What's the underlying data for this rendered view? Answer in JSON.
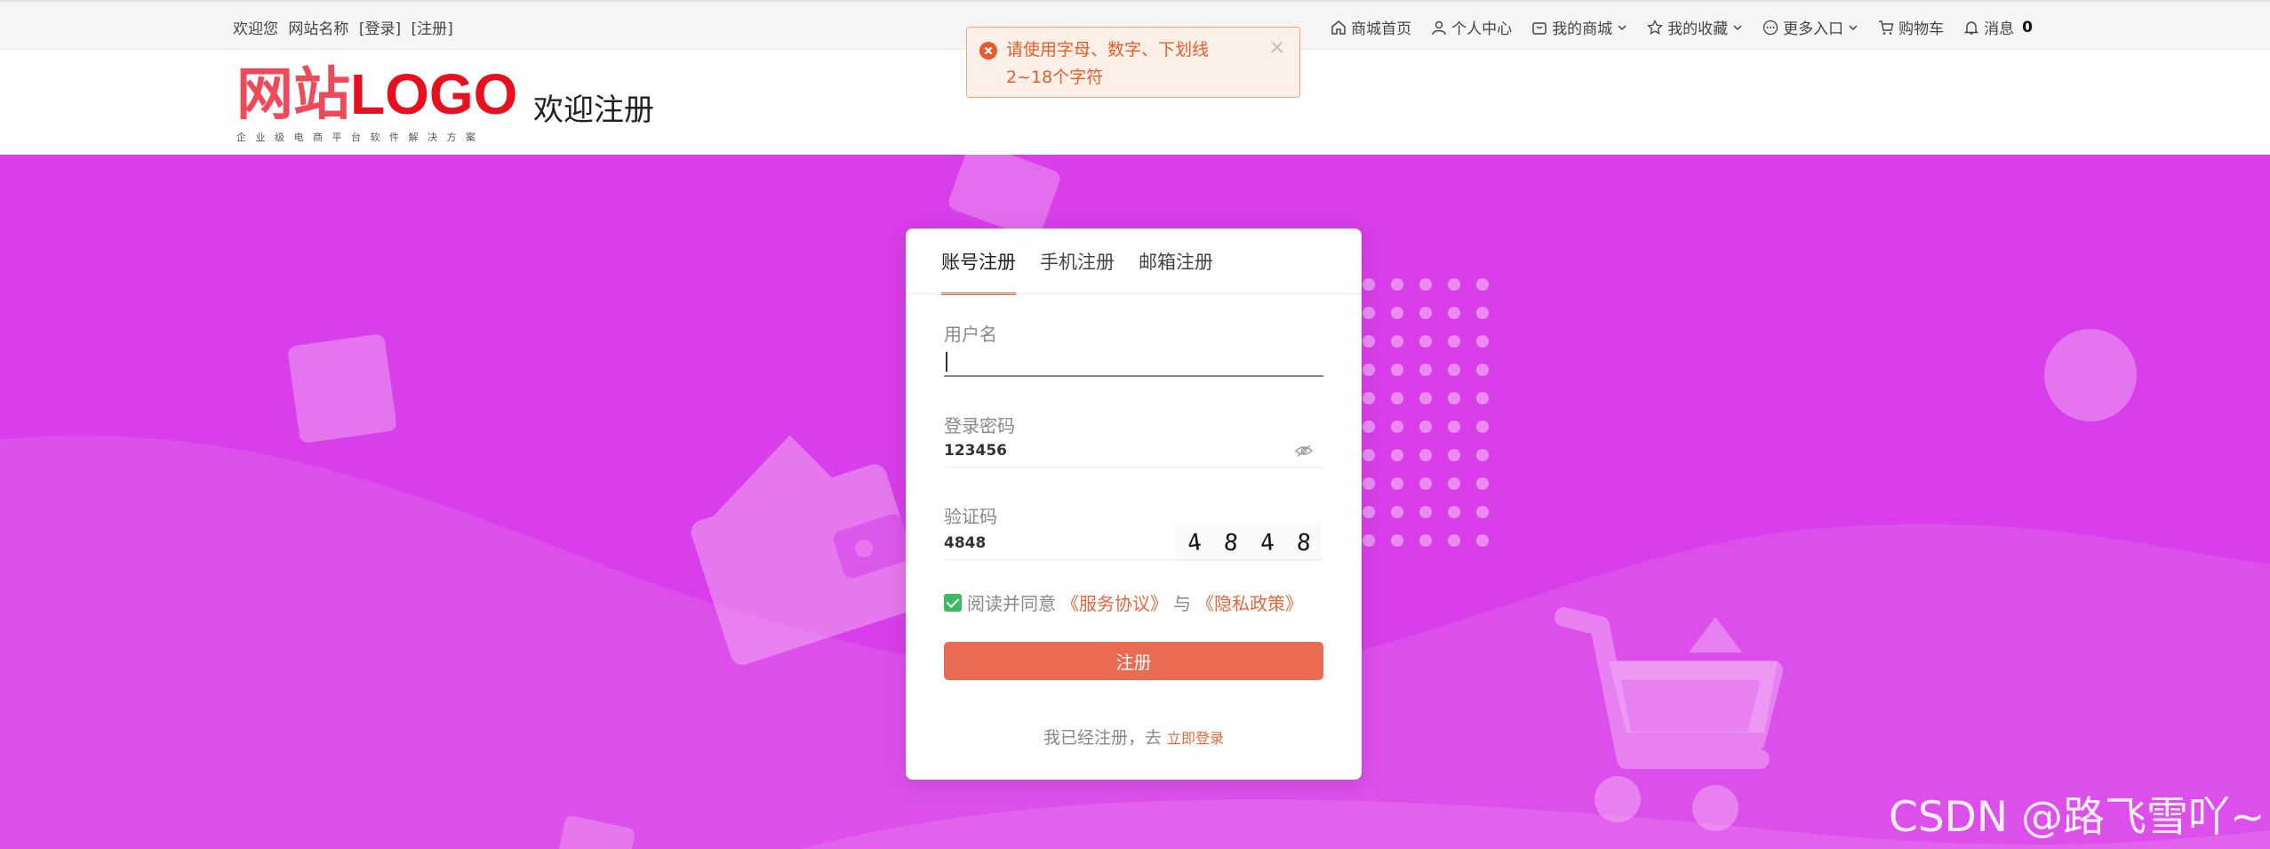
{
  "topbar": {
    "welcome": "欢迎您",
    "site_name": "网站名称",
    "login": "[登录]",
    "register": "[注册]",
    "nav": [
      {
        "label": "商城首页",
        "icon": "home-icon"
      },
      {
        "label": "个人中心",
        "icon": "user-icon"
      },
      {
        "label": "我的商城",
        "icon": "shop-icon",
        "dropdown": true
      },
      {
        "label": "我的收藏",
        "icon": "star-icon",
        "dropdown": true
      },
      {
        "label": "更多入口",
        "icon": "more-icon",
        "dropdown": true
      },
      {
        "label": "购物车",
        "icon": "cart-icon"
      },
      {
        "label": "消息",
        "icon": "bell-icon",
        "count": "0"
      }
    ]
  },
  "header": {
    "logo_cn": "网站",
    "logo_en": "LOGO",
    "logo_sub": "企业级电商平台软件解决方案",
    "page_heading": "欢迎注册"
  },
  "toast": {
    "message": "请使用字母、数字、下划线2~18个字符",
    "close": "×"
  },
  "form": {
    "tabs": [
      {
        "label": "账号注册",
        "active": true
      },
      {
        "label": "手机注册"
      },
      {
        "label": "邮箱注册"
      }
    ],
    "username": {
      "label": "用户名",
      "value": ""
    },
    "password": {
      "label": "登录密码",
      "value": "123456"
    },
    "captcha": {
      "label": "验证码",
      "value": "4848",
      "image_chars": [
        "4",
        "8",
        "4",
        "8"
      ]
    },
    "agree": {
      "checked": true,
      "text": "阅读并同意",
      "service": "《服务协议》",
      "and": "与",
      "privacy": "《隐私政策》"
    },
    "submit_label": "注册",
    "login_hint": "我已经注册，去",
    "login_link": "立即登录"
  },
  "watermark": "CSDN @路飞雪吖~",
  "colors": {
    "hero_bg": "#d83ee9",
    "accent": "#e8673a",
    "button": "#e96b52",
    "logo_red": "#e8101e",
    "check_green": "#3cba64"
  }
}
